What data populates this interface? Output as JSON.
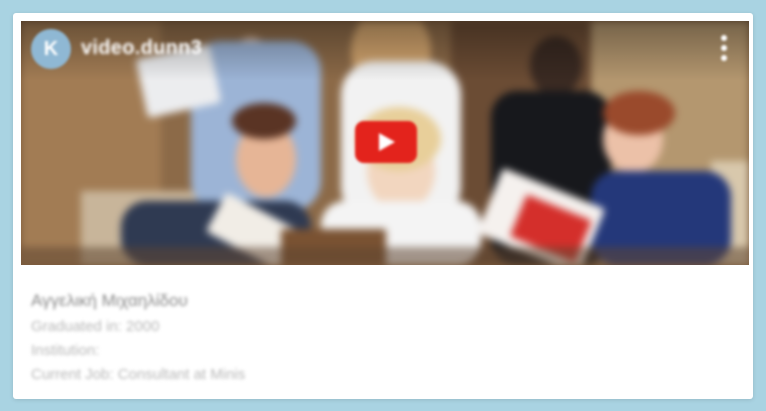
{
  "video": {
    "channel_initial": "K",
    "title": "video.dunn3",
    "play_icon": "youtube-play-icon",
    "menu_icon": "more-vertical-icon"
  },
  "profile": {
    "name": "Αγγελική Μιχαηλίδου",
    "graduated": "Graduated in: 2000",
    "institution": "Institution:",
    "current_job": "Current Job: Consultant at Minis"
  },
  "colors": {
    "page_background": "#a9d3e2",
    "card_background": "#ffffff",
    "play_button": "#e3231c"
  }
}
